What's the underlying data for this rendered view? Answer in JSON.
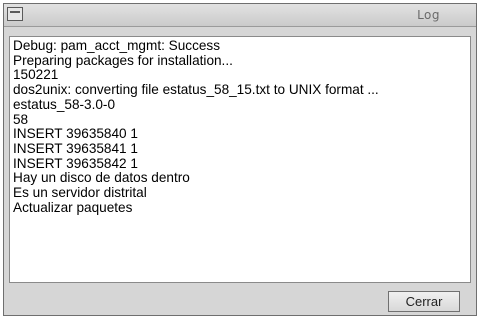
{
  "window": {
    "title": "Log",
    "icons": {
      "menu": "window-menu-icon"
    }
  },
  "log": {
    "lines": [
      "Debug: pam_acct_mgmt: Success",
      "Preparing packages for installation...",
      "150221",
      "dos2unix: converting file estatus_58_15.txt to UNIX format ...",
      "estatus_58-3.0-0",
      "58",
      "INSERT 39635840 1",
      "INSERT 39635841 1",
      "INSERT 39635842 1",
      "Hay un disco de datos dentro",
      "Es un servidor distrital",
      "Actualizar paquetes"
    ]
  },
  "footer": {
    "close_label": "Cerrar"
  }
}
